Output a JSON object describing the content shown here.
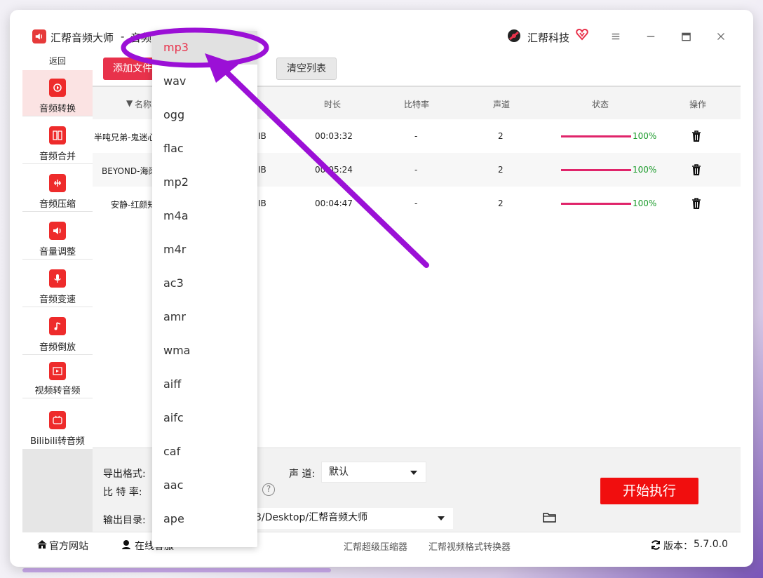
{
  "window": {
    "app_title": "汇帮音频大师",
    "title_sep": "-",
    "title_sub": "音频",
    "brand": "汇帮科技"
  },
  "sidebar": {
    "back": "返回",
    "items": [
      {
        "label": "音频转换",
        "icon": "audio-convert-icon",
        "active": true
      },
      {
        "label": "音频合并",
        "icon": "audio-merge-icon"
      },
      {
        "label": "音频压缩",
        "icon": "audio-compress-icon"
      },
      {
        "label": "音量调整",
        "icon": "volume-icon"
      },
      {
        "label": "音频变速",
        "icon": "microphone-icon"
      },
      {
        "label": "音频倒放",
        "icon": "music-note-icon"
      },
      {
        "label": "视频转音频",
        "icon": "film-icon"
      },
      {
        "label": "Bilibili转音频",
        "icon": "bilibili-icon"
      }
    ]
  },
  "toolbar": {
    "add_label": "添加文件",
    "clear_label": "清空列表"
  },
  "table": {
    "columns": [
      "名称",
      "时长",
      "比特率",
      "声道",
      "状态",
      "操作"
    ],
    "rows": [
      {
        "name": "半吨兄弟-鬼迷心",
        "size": "IB",
        "duration": "00:03:32",
        "bitrate": "-",
        "channels": "2",
        "status": "100%",
        "progress": 1.0
      },
      {
        "name": "BEYOND-海阔",
        "size": "IB",
        "duration": "00:05:24",
        "bitrate": "-",
        "channels": "2",
        "status": "100%",
        "progress": 1.0
      },
      {
        "name": "安静-红颜知",
        "size": "IB",
        "duration": "00:04:47",
        "bitrate": "-",
        "channels": "2",
        "status": "100%",
        "progress": 1.0
      }
    ]
  },
  "settings": {
    "format_label": "导出格式:",
    "channel_label": "声 道:",
    "channel_value": "默认",
    "bitrate_label": "比 特 率:",
    "output_label": "输出目录:",
    "output_value": "3/Desktop/汇帮音频大师",
    "start_label": "开始执行"
  },
  "statusbar": {
    "website": "官方网站",
    "service": "在线客服",
    "link1": "汇帮超级压缩器",
    "link2": "汇帮视频格式转换器",
    "version_label": "版本：",
    "version": "5.7.0.0"
  },
  "dropdown": {
    "selected": "mp3",
    "options": [
      "mp3",
      "wav",
      "ogg",
      "flac",
      "mp2",
      "m4a",
      "m4r",
      "ac3",
      "amr",
      "wma",
      "aiff",
      "aifc",
      "caf",
      "aac",
      "ape"
    ]
  },
  "colors": {
    "accent": "#e8324b",
    "start_button": "#f10e0e",
    "progress": "#e0246a",
    "success": "#1a9a2a",
    "annotation": "#9b10d6"
  }
}
